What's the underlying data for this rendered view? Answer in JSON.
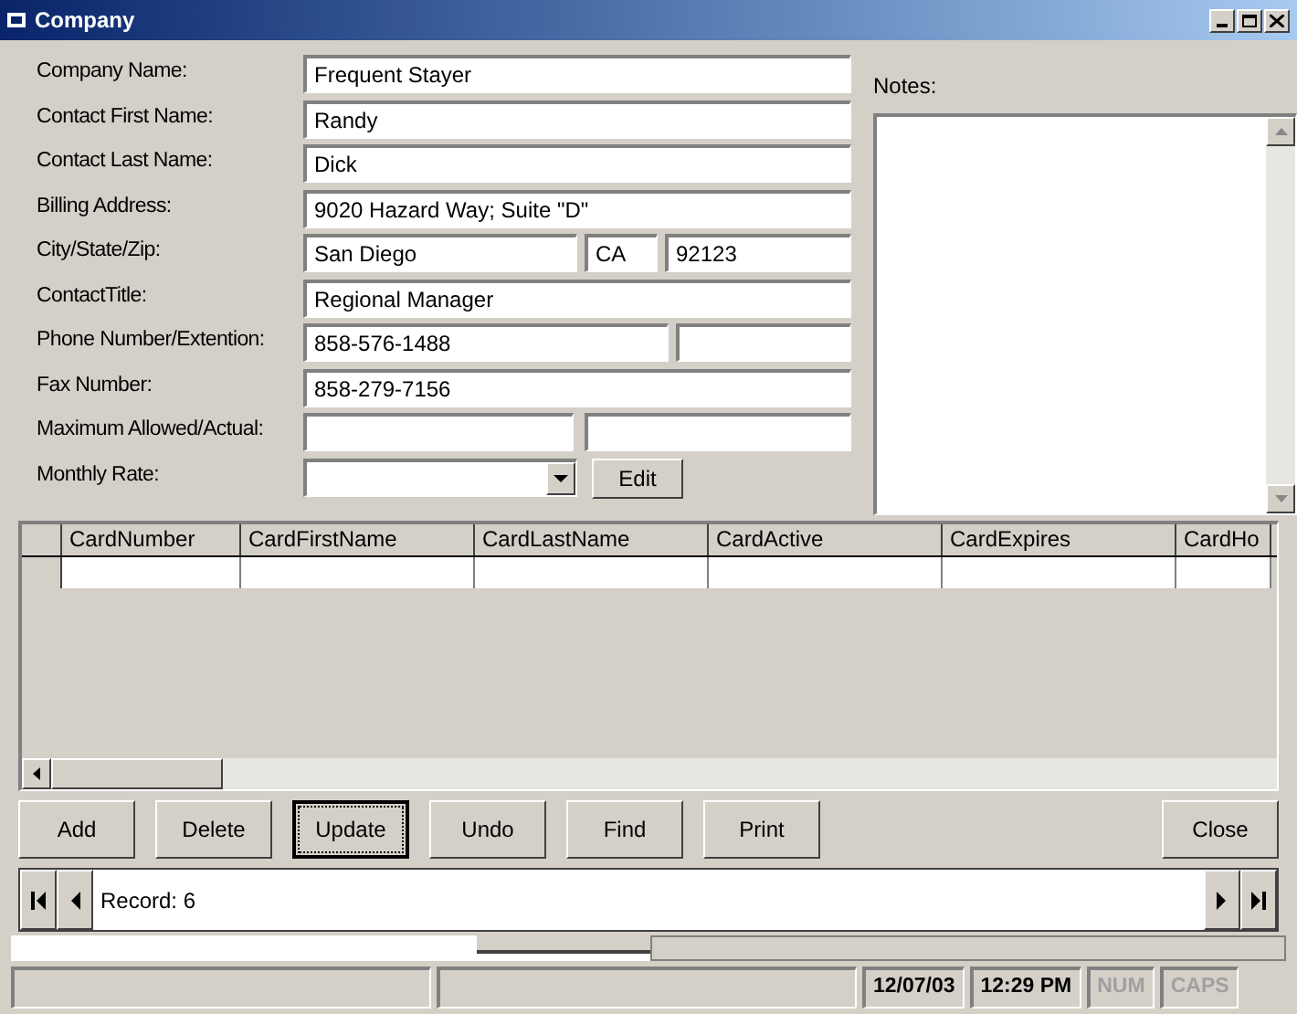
{
  "window": {
    "title": "Company"
  },
  "fields": [
    {
      "label": "Company Name:",
      "kind": "single",
      "values": [
        "Frequent Stayer"
      ]
    },
    {
      "label": "Contact First Name:",
      "kind": "single",
      "values": [
        "Randy"
      ]
    },
    {
      "label": "Contact Last Name:",
      "kind": "single",
      "values": [
        "Dick"
      ]
    },
    {
      "label": "Billing Address:",
      "kind": "single",
      "values": [
        "9020 Hazard Way; Suite \"D\""
      ]
    },
    {
      "label": "City/State/Zip:",
      "kind": "citystatezip",
      "values": [
        "San Diego",
        "CA",
        "92123"
      ]
    },
    {
      "label": "ContactTitle:",
      "kind": "single",
      "values": [
        "Regional Manager"
      ]
    },
    {
      "label": "Phone Number/Extention:",
      "kind": "pair",
      "values": [
        "858-576-1488"
      ]
    },
    {
      "label": "Fax Number:",
      "kind": "single",
      "values": [
        "858-279-7156"
      ]
    },
    {
      "label": "Maximum Allowed/Actual:",
      "kind": "halves"
    },
    {
      "label": "Monthly Rate:",
      "kind": "combo",
      "button": "Edit"
    }
  ],
  "notes": {
    "label": "Notes:"
  },
  "grid": {
    "columns": [
      "CardNumber",
      "CardFirstName",
      "CardLastName",
      "CardActive",
      "CardExpires",
      "CardHo"
    ]
  },
  "buttons": [
    {
      "label": "Add",
      "focused": false
    },
    {
      "label": "Delete",
      "focused": false
    },
    {
      "label": "Update",
      "focused": true
    },
    {
      "label": "Undo",
      "focused": false
    },
    {
      "label": "Find",
      "focused": false
    },
    {
      "label": "Print",
      "focused": false
    },
    {
      "label": "Close",
      "focused": false
    }
  ],
  "record": {
    "text": "Record: 6"
  },
  "status_bar": [
    {
      "text": "12/07/03",
      "disabled": false
    },
    {
      "text": "12:29 PM",
      "disabled": false
    },
    {
      "text": "NUM",
      "disabled": true
    },
    {
      "text": "CAPS",
      "disabled": true
    }
  ]
}
